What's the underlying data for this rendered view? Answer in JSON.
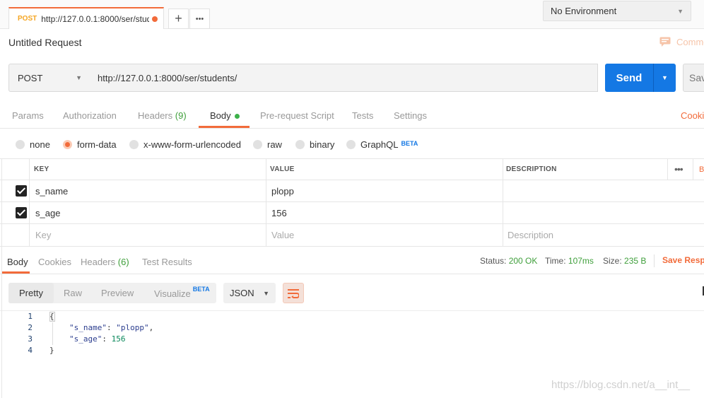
{
  "tab": {
    "method": "POST",
    "url": "http://127.0.0.1:8000/ser/stud…"
  },
  "tab_actions": {
    "add": "+",
    "more": "•••"
  },
  "environment": {
    "selected": "No Environment"
  },
  "request": {
    "title": "Untitled Request",
    "comments_label": "Comme",
    "method": "POST",
    "url": "http://127.0.0.1:8000/ser/students/",
    "send_label": "Send",
    "save_label": "Sav"
  },
  "request_tabs": {
    "params": "Params",
    "authorization": "Authorization",
    "headers": "Headers",
    "headers_count": "(9)",
    "body": "Body",
    "prerequest": "Pre-request Script",
    "tests": "Tests",
    "settings": "Settings",
    "cookies": "Cookie"
  },
  "body_types": {
    "none": "none",
    "form_data": "form-data",
    "urlencoded": "x-www-form-urlencoded",
    "raw": "raw",
    "binary": "binary",
    "graphql": "GraphQL",
    "beta": "BETA",
    "selected": "form-data"
  },
  "kv_table": {
    "headers": {
      "key": "KEY",
      "value": "VALUE",
      "description": "DESCRIPTION",
      "more": "•••",
      "bulk": "B"
    },
    "rows": [
      {
        "checked": true,
        "key": "s_name",
        "value": "plopp"
      },
      {
        "checked": true,
        "key": "s_age",
        "value": "156"
      }
    ],
    "placeholders": {
      "key": "Key",
      "value": "Value",
      "description": "Description"
    }
  },
  "response_tabs": {
    "body": "Body",
    "cookies": "Cookies",
    "headers": "Headers",
    "headers_count": "(6)",
    "test_results": "Test Results"
  },
  "response_status": {
    "status_label": "Status:",
    "status_value": "200 OK",
    "time_label": "Time:",
    "time_value": "107ms",
    "size_label": "Size:",
    "size_value": "235 B",
    "save_response": "Save Resp"
  },
  "view_modes": {
    "pretty": "Pretty",
    "raw": "Raw",
    "preview": "Preview",
    "visualize": "Visualize",
    "beta": "BETA",
    "format": "JSON"
  },
  "code": {
    "line_numbers": [
      "1",
      "2",
      "3",
      "4"
    ],
    "open_brace": "{",
    "close_brace": "}",
    "name_key": "\"s_name\"",
    "name_value": "\"plopp\"",
    "age_key": "\"s_age\"",
    "age_value": "156"
  },
  "watermark": "https://blog.csdn.net/a__int__",
  "colors": {
    "accent": "#f26b3a",
    "send": "#1478e4",
    "success": "#3f9f3b"
  }
}
